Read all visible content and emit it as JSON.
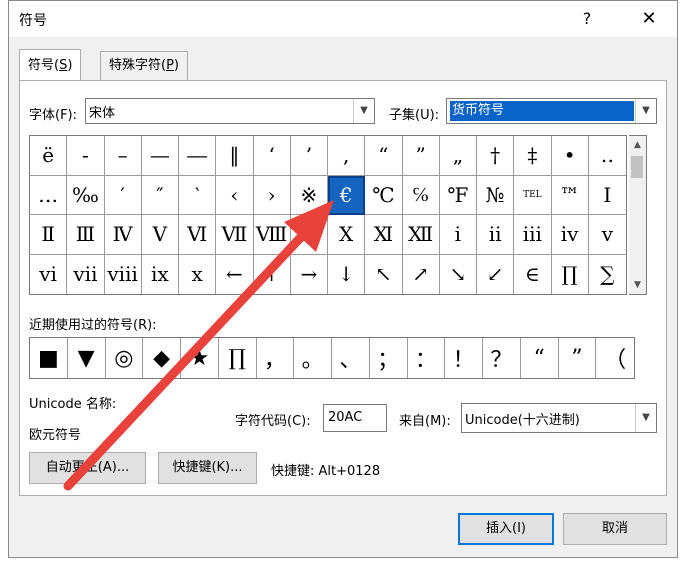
{
  "window": {
    "title": "符号",
    "help_label": "?",
    "close_label": "✕"
  },
  "tabs": [
    {
      "label": "符号(",
      "hotkey": "S",
      "suffix": ")"
    },
    {
      "label": "特殊字符(",
      "hotkey": "P",
      "suffix": ")"
    }
  ],
  "font": {
    "label": "字体(F):",
    "value": "宋体"
  },
  "subset": {
    "label": "子集(U):",
    "value": "货币符号"
  },
  "symbol_rows": [
    [
      "ë",
      "-",
      "–",
      "—",
      "―",
      "‖",
      "‘",
      "’",
      ",",
      "“",
      "”",
      "„",
      "†",
      "‡",
      "•",
      "‥"
    ],
    [
      "…",
      "‰",
      "′",
      "″",
      "‵",
      "‹",
      "›",
      "※",
      "€",
      "℃",
      "℅",
      "℉",
      "№",
      "TEL",
      "™",
      "Ⅰ"
    ],
    [
      "Ⅱ",
      "Ⅲ",
      "Ⅳ",
      "Ⅴ",
      "Ⅵ",
      "Ⅶ",
      "Ⅷ",
      "Ⅸ",
      "Ⅹ",
      "Ⅺ",
      "Ⅻ",
      "ⅰ",
      "ⅱ",
      "ⅲ",
      "ⅳ",
      "ⅴ"
    ],
    [
      "ⅵ",
      "ⅶ",
      "ⅷ",
      "ⅸ",
      "ⅹ",
      "←",
      "↑",
      "→",
      "↓",
      "↖",
      "↗",
      "↘",
      "↙",
      "∈",
      "∏",
      "∑"
    ]
  ],
  "selected_symbol": "€",
  "recent": {
    "label": "近期使用过的符号(R):",
    "symbols": [
      "■",
      "▼",
      "◎",
      "◆",
      "★",
      "∏",
      "，",
      "。",
      "、",
      "；",
      "：",
      "！",
      "？",
      "“",
      "”",
      "（"
    ]
  },
  "unicode_name_label": "Unicode 名称:",
  "unicode_name_value": "欧元符号",
  "char_code": {
    "label": "字符代码(C):",
    "value": "20AC"
  },
  "from": {
    "label": "来自(M):",
    "value": "Unicode(十六进制)"
  },
  "buttons": {
    "autocorrect": "自动更正(A)...",
    "shortcut_key": "快捷键(K)...",
    "insert": "插入(I)",
    "cancel": "取消"
  },
  "shortcut_text": "快捷键: Alt+0128",
  "colors": {
    "selection": "#1565c0",
    "annotation_arrow": "#e8423a"
  }
}
